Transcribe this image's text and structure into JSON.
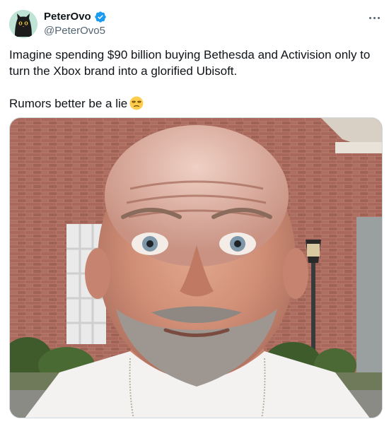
{
  "author": {
    "display_name": "PeterOvo",
    "handle": "@PeterOvo5",
    "verified": true,
    "avatar_icon": "black-cat-avatar",
    "verified_color": "#1d9bf0"
  },
  "tweet": {
    "line1": "Imagine spending $90 billion buying Bethesda and Activision only to turn the Xbox brand into a glorified Ubisoft.",
    "line2": "Rumors better be a lie",
    "emoji": "unamused-face-emoji"
  },
  "media": {
    "type": "photo"
  },
  "colors": {
    "text": "#0f1419",
    "secondary": "#536471",
    "border": "#cfd9de"
  }
}
